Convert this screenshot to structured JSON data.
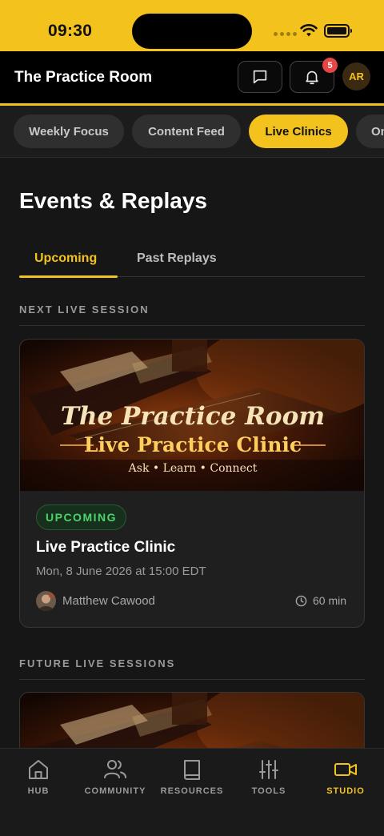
{
  "status_bar": {
    "time": "09:30"
  },
  "header": {
    "title": "The Practice Room",
    "notification_count": "5",
    "avatar_initials": "AR"
  },
  "chips": [
    {
      "label": "Weekly Focus"
    },
    {
      "label": "Content Feed"
    },
    {
      "label": "Live Clinics",
      "active": true
    },
    {
      "label": "On"
    }
  ],
  "section": {
    "title": "Events & Replays",
    "tabs": [
      {
        "label": "Upcoming",
        "active": true
      },
      {
        "label": "Past Replays"
      }
    ]
  },
  "next_session": {
    "overline": "NEXT LIVE SESSION",
    "banner": {
      "line1": "The Practice Room",
      "line2": "Live Practice Clinic",
      "line3": "Ask • Learn • Connect"
    },
    "status": "UPCOMING",
    "title": "Live Practice Clinic",
    "datetime": "Mon, 8 June 2026 at 15:00 EDT",
    "host": "Matthew Cawood",
    "duration": "60 min"
  },
  "future_sessions": {
    "overline": "FUTURE LIVE SESSIONS"
  },
  "bottom_nav": [
    {
      "label": "HUB",
      "icon": "home-icon"
    },
    {
      "label": "COMMUNITY",
      "icon": "users-icon"
    },
    {
      "label": "RESOURCES",
      "icon": "book-icon"
    },
    {
      "label": "TOOLS",
      "icon": "sliders-icon"
    },
    {
      "label": "STUDIO",
      "icon": "video-camera-icon",
      "active": true
    }
  ],
  "colors": {
    "accent": "#f4c21c",
    "background": "#161616",
    "success": "#4cd36a",
    "badge": "#e84545"
  }
}
